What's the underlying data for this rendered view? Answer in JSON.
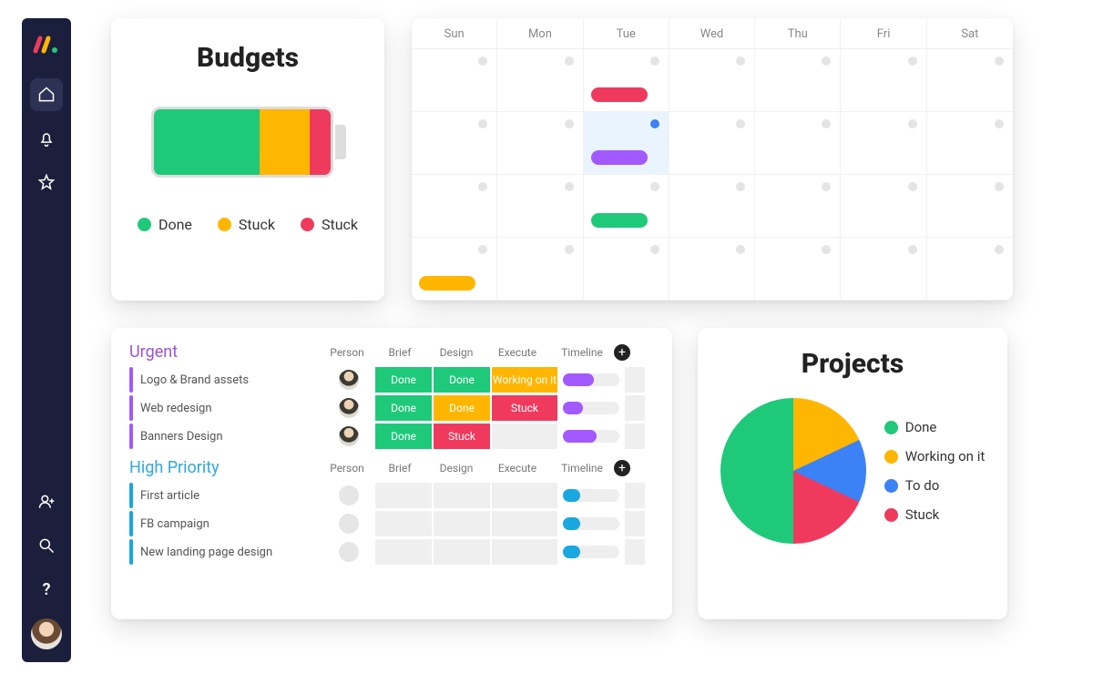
{
  "colors": {
    "green": "#1fc97a",
    "orange": "#ffb600",
    "red": "#ef3a5d",
    "purple": "#a259ff",
    "blue": "#3b82f6",
    "cyan": "#19a7e0"
  },
  "sidebar": {
    "items": [
      "home",
      "bell",
      "star"
    ],
    "bottom": [
      "add-user",
      "search",
      "help"
    ]
  },
  "budgets": {
    "title": "Budgets",
    "segments": [
      {
        "label": "Done",
        "color": "#1fc97a",
        "pct": 60
      },
      {
        "label": "Stuck",
        "color": "#ffb600",
        "pct": 28
      },
      {
        "label": "Stuck",
        "color": "#ef3a5d",
        "pct": 12
      }
    ],
    "legend": [
      {
        "label": "Done",
        "color": "#1fc97a"
      },
      {
        "label": "Stuck",
        "color": "#ffb600"
      },
      {
        "label": "Stuck",
        "color": "#ef3a5d"
      }
    ]
  },
  "calendar": {
    "days": [
      "Sun",
      "Mon",
      "Tue",
      "Wed",
      "Thu",
      "Fri",
      "Sat"
    ],
    "rows": 4,
    "highlight": {
      "row": 1,
      "col": 2
    },
    "events": [
      {
        "row": 0,
        "col": 2,
        "color": "#ef3a5d"
      },
      {
        "row": 1,
        "col": 2,
        "color": "#a259ff"
      },
      {
        "row": 2,
        "col": 2,
        "color": "#1fc97a"
      },
      {
        "row": 3,
        "col": 0,
        "color": "#ffb600"
      }
    ]
  },
  "tasks": {
    "columns": [
      "Person",
      "Brief",
      "Design",
      "Execute",
      "Timeline"
    ],
    "groups": [
      {
        "title": "Urgent",
        "color": "#a259ff",
        "class": "title-urgent",
        "rows": [
          {
            "name": "Logo & Brand assets",
            "person": "avatar",
            "cells": [
              {
                "label": "Done",
                "color": "#1fc97a"
              },
              {
                "label": "Done",
                "color": "#1fc97a"
              },
              {
                "label": "Working on it",
                "color": "#ffb600"
              }
            ],
            "timeline": {
              "color": "#a259ff",
              "pct": 55
            }
          },
          {
            "name": "Web redesign",
            "person": "avatar",
            "cells": [
              {
                "label": "Done",
                "color": "#1fc97a"
              },
              {
                "label": "Done",
                "color": "#ffb600"
              },
              {
                "label": "Stuck",
                "color": "#ef3a5d"
              }
            ],
            "timeline": {
              "color": "#a259ff",
              "pct": 35
            }
          },
          {
            "name": "Banners Design",
            "person": "avatar",
            "cells": [
              {
                "label": "Done",
                "color": "#1fc97a"
              },
              {
                "label": "Stuck",
                "color": "#ef3a5d"
              },
              {
                "label": "",
                "color": "#efefef"
              }
            ],
            "timeline": {
              "color": "#a259ff",
              "pct": 60
            }
          }
        ]
      },
      {
        "title": "High Priority",
        "color": "#19a7e0",
        "class": "title-high",
        "rows": [
          {
            "name": "First article",
            "person": "empty",
            "cells": [
              {
                "label": "",
                "color": "#efefef"
              },
              {
                "label": "",
                "color": "#efefef"
              },
              {
                "label": "",
                "color": "#efefef"
              }
            ],
            "timeline": {
              "color": "#19a7e0",
              "pct": 30
            }
          },
          {
            "name": "FB campaign",
            "person": "empty",
            "cells": [
              {
                "label": "",
                "color": "#efefef"
              },
              {
                "label": "",
                "color": "#efefef"
              },
              {
                "label": "",
                "color": "#efefef"
              }
            ],
            "timeline": {
              "color": "#19a7e0",
              "pct": 30
            }
          },
          {
            "name": "New landing page design",
            "person": "empty",
            "cells": [
              {
                "label": "",
                "color": "#efefef"
              },
              {
                "label": "",
                "color": "#efefef"
              },
              {
                "label": "",
                "color": "#efefef"
              }
            ],
            "timeline": {
              "color": "#19a7e0",
              "pct": 30
            }
          }
        ]
      }
    ]
  },
  "projects": {
    "title": "Projects",
    "legend": [
      {
        "label": "Done",
        "color": "#1fc97a"
      },
      {
        "label": "Working on it",
        "color": "#ffb600"
      },
      {
        "label": "To do",
        "color": "#3b82f6"
      },
      {
        "label": "Stuck",
        "color": "#ef3a5d"
      }
    ]
  },
  "chart_data": {
    "type": "pie",
    "title": "Projects",
    "series": [
      {
        "name": "Done",
        "value": 50,
        "color": "#1fc97a"
      },
      {
        "name": "Working on it",
        "value": 18,
        "color": "#ffb600"
      },
      {
        "name": "To do",
        "value": 14,
        "color": "#3b82f6"
      },
      {
        "name": "Stuck",
        "value": 18,
        "color": "#ef3a5d"
      }
    ]
  }
}
